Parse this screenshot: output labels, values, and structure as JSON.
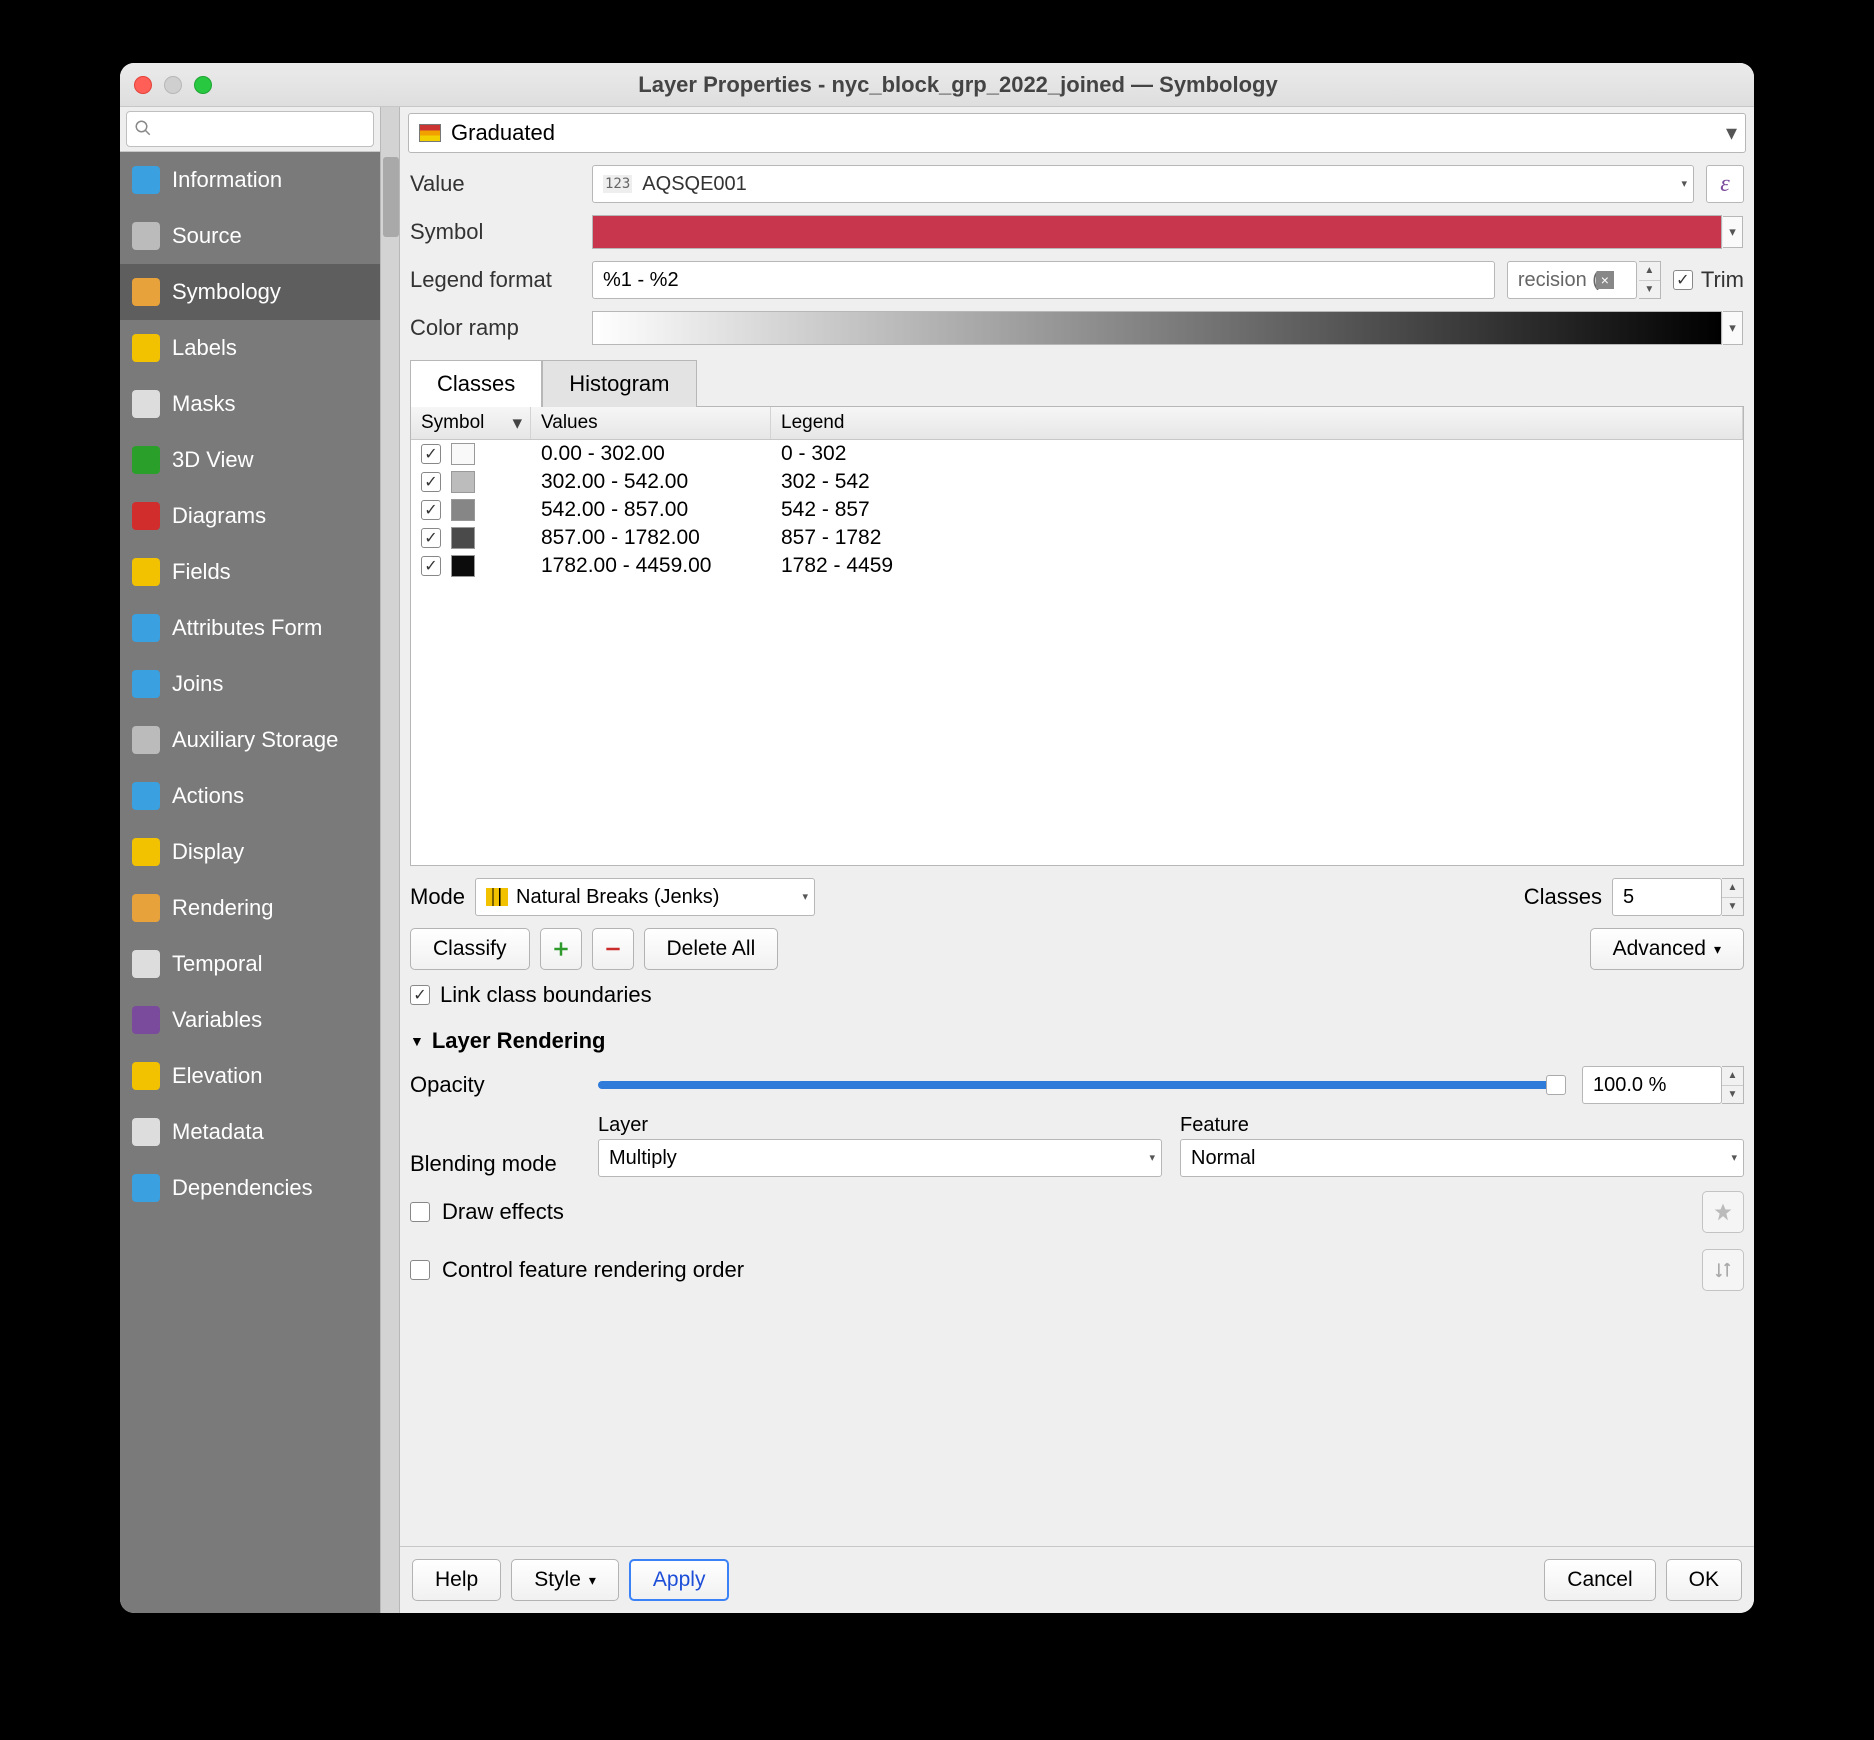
{
  "window_title": "Layer Properties - nyc_block_grp_2022_joined — Symbology",
  "search_placeholder": "",
  "sidebar": {
    "items": [
      {
        "label": "Information"
      },
      {
        "label": "Source"
      },
      {
        "label": "Symbology"
      },
      {
        "label": "Labels"
      },
      {
        "label": "Masks"
      },
      {
        "label": "3D View"
      },
      {
        "label": "Diagrams"
      },
      {
        "label": "Fields"
      },
      {
        "label": "Attributes Form"
      },
      {
        "label": "Joins"
      },
      {
        "label": "Auxiliary Storage"
      },
      {
        "label": "Actions"
      },
      {
        "label": "Display"
      },
      {
        "label": "Rendering"
      },
      {
        "label": "Temporal"
      },
      {
        "label": "Variables"
      },
      {
        "label": "Elevation"
      },
      {
        "label": "Metadata"
      },
      {
        "label": "Dependencies"
      }
    ],
    "active_index": 2
  },
  "renderer_type": "Graduated",
  "value": {
    "label": "Value",
    "field_type_tag": "123",
    "field": "AQSQE001",
    "expr_btn": "ε"
  },
  "symbol": {
    "label": "Symbol",
    "color": "#c8364e"
  },
  "legend_format": {
    "label": "Legend format",
    "pattern": "%1 - %2",
    "precision_placeholder": "recision (",
    "trim_label": "Trim",
    "trim_checked": true
  },
  "color_ramp": {
    "label": "Color ramp"
  },
  "tabs": {
    "classes": "Classes",
    "histogram": "Histogram",
    "active": "classes"
  },
  "class_table": {
    "headers": {
      "symbol": "Symbol",
      "values": "Values",
      "legend": "Legend"
    },
    "rows": [
      {
        "checked": true,
        "swatch": "#f9f9f9",
        "values": "0.00 - 302.00",
        "legend": "0 - 302"
      },
      {
        "checked": true,
        "swatch": "#bcbcbc",
        "values": "302.00 - 542.00",
        "legend": "302 - 542"
      },
      {
        "checked": true,
        "swatch": "#868686",
        "values": "542.00 - 857.00",
        "legend": "542 - 857"
      },
      {
        "checked": true,
        "swatch": "#4a4a4a",
        "values": "857.00 - 1782.00",
        "legend": "857 - 1782"
      },
      {
        "checked": true,
        "swatch": "#0c0c0c",
        "values": "1782.00 - 4459.00",
        "legend": "1782 - 4459"
      }
    ]
  },
  "mode": {
    "label": "Mode",
    "value": "Natural Breaks (Jenks)"
  },
  "classes_count": {
    "label": "Classes",
    "value": "5"
  },
  "buttons": {
    "classify": "Classify",
    "delete_all": "Delete All",
    "advanced": "Advanced"
  },
  "link_boundaries": {
    "label": "Link class boundaries",
    "checked": true
  },
  "layer_rendering": {
    "heading": "Layer Rendering",
    "opacity_label": "Opacity",
    "opacity_value": "100.0 %",
    "blending_label": "Blending mode",
    "layer_label": "Layer",
    "feature_label": "Feature",
    "layer_mode": "Multiply",
    "feature_mode": "Normal",
    "draw_effects": "Draw effects",
    "draw_effects_checked": false,
    "control_order": "Control feature rendering order",
    "control_order_checked": false
  },
  "footer": {
    "help": "Help",
    "style": "Style",
    "apply": "Apply",
    "cancel": "Cancel",
    "ok": "OK"
  },
  "chart_data": {
    "type": "table",
    "title": "Graduated classification — AQSQE001",
    "mode": "Natural Breaks (Jenks)",
    "classes": 5,
    "breaks": [
      0.0,
      302.0,
      542.0,
      857.0,
      1782.0,
      4459.0
    ],
    "series": [
      {
        "range": [
          0.0,
          302.0
        ],
        "legend": "0 - 302",
        "color": "#f9f9f9"
      },
      {
        "range": [
          302.0,
          542.0
        ],
        "legend": "302 - 542",
        "color": "#bcbcbc"
      },
      {
        "range": [
          542.0,
          857.0
        ],
        "legend": "542 - 857",
        "color": "#868686"
      },
      {
        "range": [
          857.0,
          1782.0
        ],
        "legend": "857 - 1782",
        "color": "#4a4a4a"
      },
      {
        "range": [
          1782.0,
          4459.0
        ],
        "legend": "1782 - 4459",
        "color": "#0c0c0c"
      }
    ]
  }
}
